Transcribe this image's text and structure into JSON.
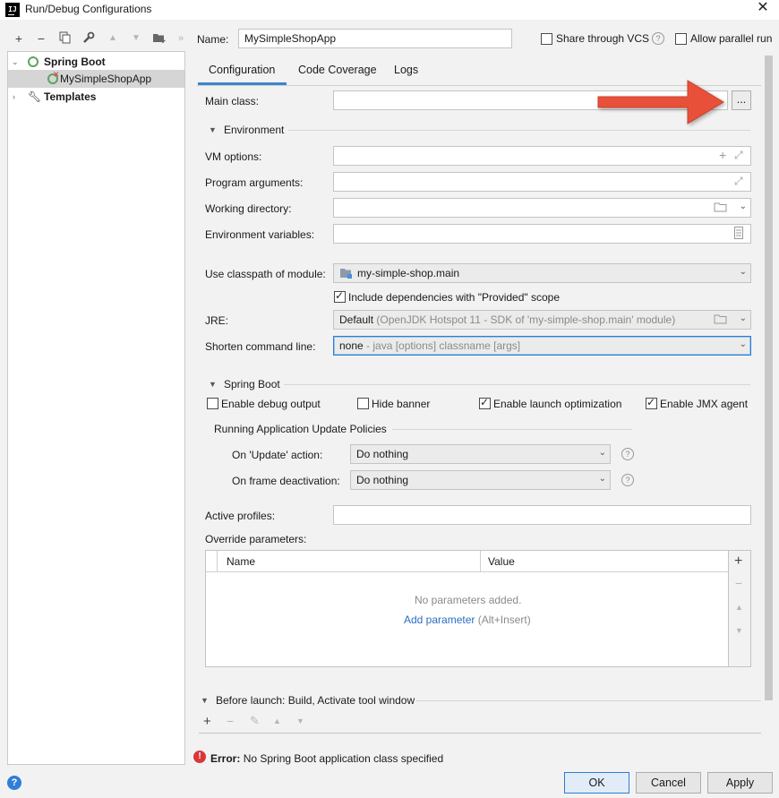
{
  "window": {
    "title": "Run/Debug Configurations",
    "app_icon_text": "IJ"
  },
  "tree": {
    "root_label": "Spring Boot",
    "child_label": "MySimpleShopApp",
    "templates_label": "Templates"
  },
  "header": {
    "name_label": "Name:",
    "name_value": "MySimpleShopApp",
    "share_vcs_label": "Share through VCS",
    "share_vcs_checked": false,
    "parallel_label": "Allow parallel run",
    "parallel_checked": false
  },
  "tabs": [
    {
      "label": "Configuration",
      "active": true
    },
    {
      "label": "Code Coverage",
      "active": false
    },
    {
      "label": "Logs",
      "active": false
    }
  ],
  "config": {
    "main_class_label": "Main class:",
    "main_class_value": "",
    "browse_label": "...",
    "environment_section": "Environment",
    "vm_options_label": "VM options:",
    "program_args_label": "Program arguments:",
    "working_dir_label": "Working directory:",
    "env_vars_label": "Environment variables:",
    "classpath_label": "Use classpath of module:",
    "classpath_value": "my-simple-shop.main",
    "include_deps_label": "Include dependencies with \"Provided\" scope",
    "include_deps_checked": true,
    "jre_label": "JRE:",
    "jre_value": "Default",
    "jre_hint": "(OpenJDK Hotspot 11 - SDK of 'my-simple-shop.main' module)",
    "shorten_label": "Shorten command line:",
    "shorten_value": "none",
    "shorten_hint": "- java [options] classname [args]",
    "spring_section": "Spring Boot",
    "debug_output_label": "Enable debug output",
    "hide_banner_label": "Hide banner",
    "launch_opt_label": "Enable launch optimization",
    "jmx_label": "Enable JMX agent",
    "update_policies_section": "Running Application Update Policies",
    "on_update_label": "On 'Update' action:",
    "on_update_value": "Do nothing",
    "on_frame_label": "On frame deactivation:",
    "on_frame_value": "Do nothing",
    "active_profiles_label": "Active profiles:",
    "override_label": "Override parameters:",
    "table_col_name": "Name",
    "table_col_value": "Value",
    "no_params": "No parameters added.",
    "add_param_link": "Add parameter",
    "add_param_shortcut": "(Alt+Insert)",
    "before_launch": "Before launch: Build, Activate tool window"
  },
  "status": {
    "error_prefix": "Error:",
    "error_text": "No Spring Boot application class specified"
  },
  "buttons": {
    "ok": "OK",
    "cancel": "Cancel",
    "apply": "Apply",
    "help": "?"
  },
  "colors": {
    "accent": "#2e7dd1",
    "error": "#d9383a",
    "arrow": "#e8503a"
  }
}
